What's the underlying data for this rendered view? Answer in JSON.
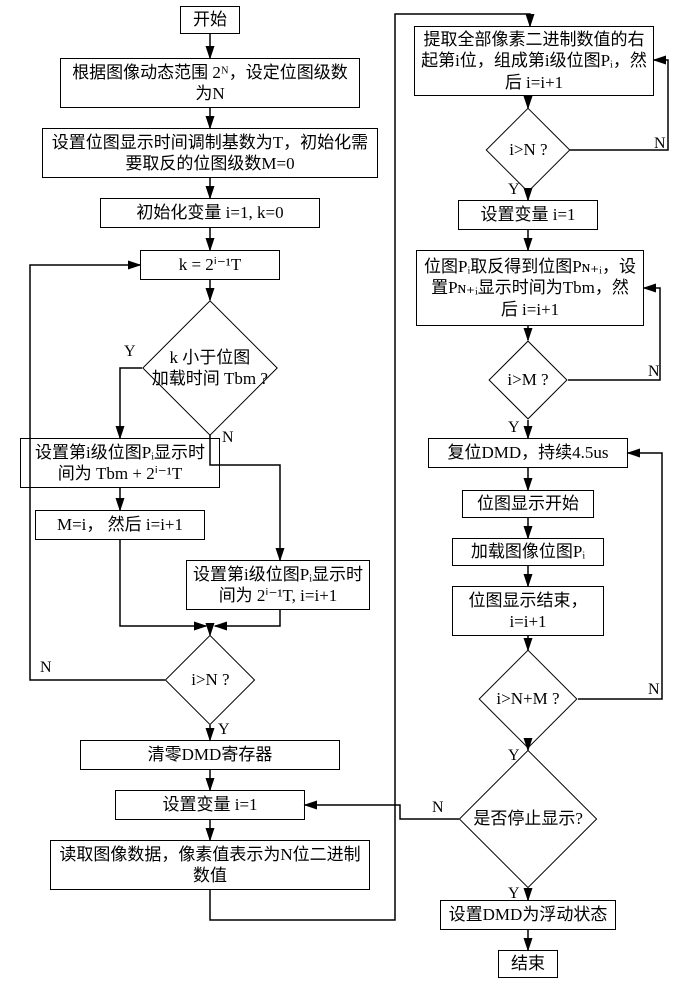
{
  "start": "开始",
  "end": "结束",
  "a1": "根据图像动态范围 2ᴺ，设定位图级数为N",
  "a2": "设置位图显示时间调制基数为T，初始化需要取反的位图级数M=0",
  "a3": "初始化变量 i=1,  k=0",
  "a4": "k = 2ⁱ⁻¹T",
  "d1_l1": "k 小于位图",
  "d1_l2": "加载时间 Tbm ?",
  "a5": "设置第i级位图Pᵢ显示时间为 Tbm + 2ⁱ⁻¹T",
  "a6": "M=i， 然后 i=i+1",
  "a7": "设置第i级位图Pᵢ显示时间为 2ⁱ⁻¹T,  i=i+1",
  "d2": "i>N ?",
  "a8": "清零DMD寄存器",
  "a9": "设置变量 i=1",
  "a10": "读取图像数据，像素值表示为N位二进制数值",
  "b1": "提取全部像素二进制数值的右起第i位，组成第i级位图Pᵢ，然后 i=i+1",
  "d3": "i>N ?",
  "b2": "设置变量 i=1",
  "b3": "位图Pᵢ取反得到位图Pɴ₊ᵢ，设置Pɴ₊ᵢ显示时间为Tbm，然后 i=i+1",
  "d4": "i>M ?",
  "b4": "复位DMD，持续4.5us",
  "b5": "位图显示开始",
  "b6": "加载图像位图Pᵢ",
  "b7": "位图显示结束，i=i+1",
  "d5": "i>N+M ?",
  "d6": "是否停止显示?",
  "b8": "设置DMD为浮动状态",
  "Y": "Y",
  "N": "N"
}
